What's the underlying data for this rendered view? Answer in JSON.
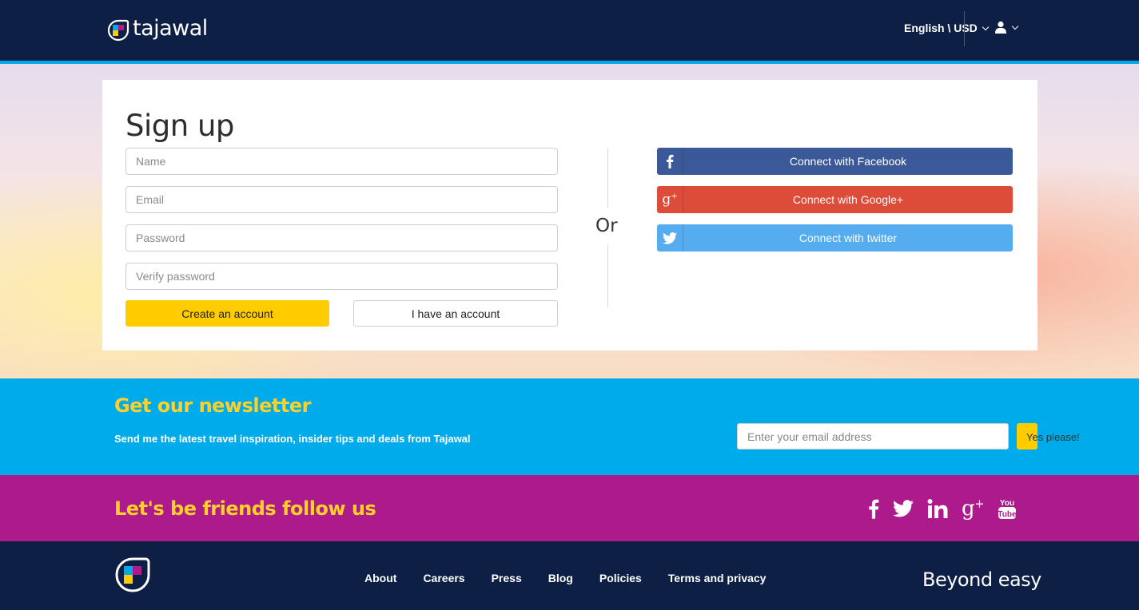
{
  "header": {
    "brand": "tajawal",
    "locale_currency": "English \\ USD"
  },
  "signup": {
    "title": "Sign up",
    "name_placeholder": "Name",
    "email_placeholder": "Email",
    "password_placeholder": "Password",
    "verify_placeholder": "Verify password",
    "create_label": "Create an account",
    "have_account_label": "I have an account",
    "or_label": "Or",
    "social": [
      {
        "label": "Connect with Facebook",
        "icon": "facebook-icon",
        "color": "#3b5998"
      },
      {
        "label": "Connect with Google+",
        "icon": "google-plus-icon",
        "color": "#dd4b39"
      },
      {
        "label": "Connect with twitter",
        "icon": "twitter-icon",
        "color": "#55acee"
      }
    ]
  },
  "newsletter": {
    "title": "Get our newsletter",
    "text": "Send me the latest travel inspiration, insider tips and deals from",
    "text_brand": "Tajawal",
    "email_placeholder": "Enter your email address",
    "button_label": "Yes please!"
  },
  "follow": {
    "title": "Let's be friends follow us",
    "icons": [
      "facebook-icon",
      "twitter-icon",
      "linkedin-icon",
      "google-plus-icon",
      "youtube-icon"
    ]
  },
  "footer": {
    "nav": [
      "About",
      "Careers",
      "Press",
      "Blog",
      "Policies",
      "Terms and privacy"
    ],
    "tagline": "Beyond easy"
  },
  "colors": {
    "header_bg": "#0d1f44",
    "accent_blue": "#00abeb",
    "accent_yellow": "#ffcc00",
    "newsletter_title": "#ffd02a",
    "follow_bg": "#ac1a8b"
  }
}
